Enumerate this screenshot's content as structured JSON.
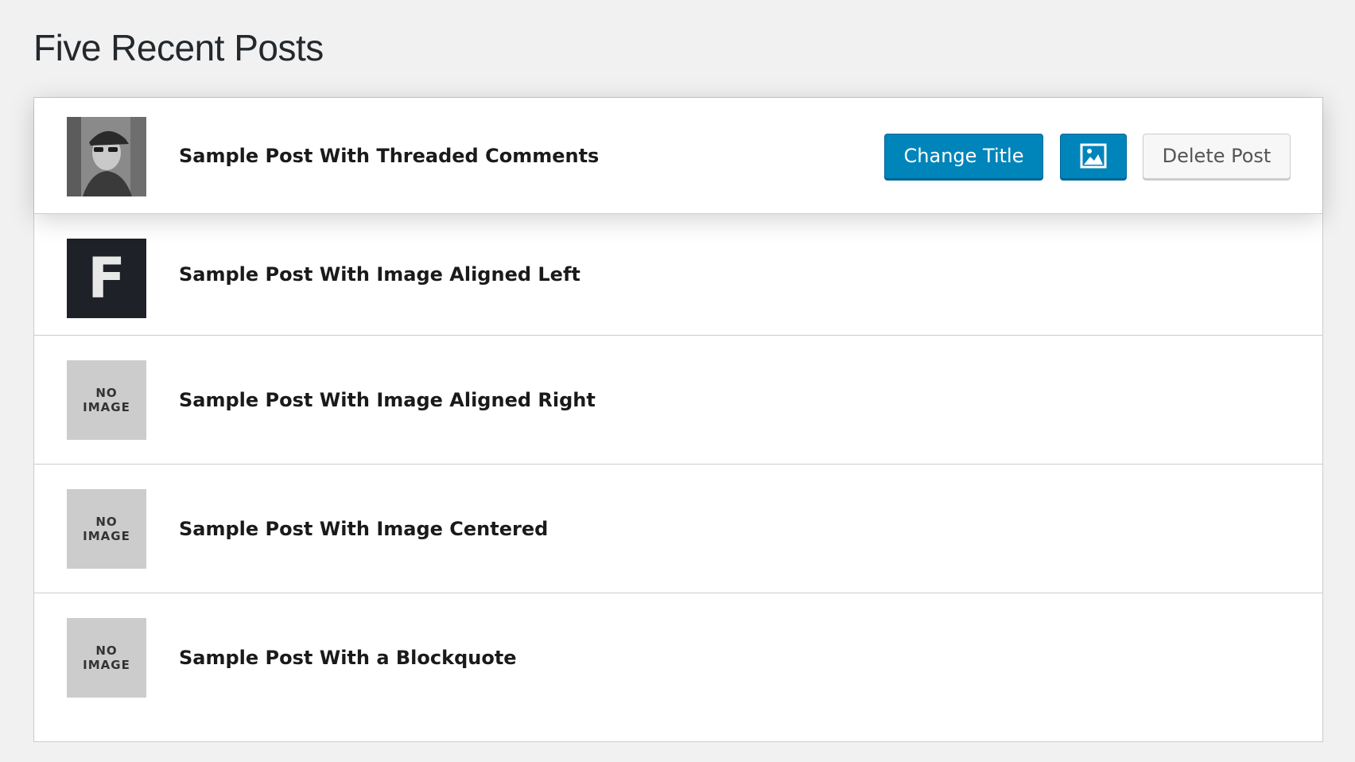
{
  "page": {
    "title": "Five Recent Posts"
  },
  "posts": [
    {
      "title": "Sample Post With Threaded Comments",
      "thumbnail": "photo",
      "active": true
    },
    {
      "title": "Sample Post With Image Aligned Left",
      "thumbnail": "letter",
      "thumbnail_letter": "F"
    },
    {
      "title": "Sample Post With Image Aligned Right",
      "thumbnail": "none",
      "no_image_line1": "NO",
      "no_image_line2": "IMAGE"
    },
    {
      "title": "Sample Post With Image Centered",
      "thumbnail": "none",
      "no_image_line1": "NO",
      "no_image_line2": "IMAGE"
    },
    {
      "title": "Sample Post With a Blockquote",
      "thumbnail": "none",
      "no_image_line1": "NO",
      "no_image_line2": "IMAGE"
    }
  ],
  "actions": {
    "change_title_label": "Change Title",
    "image_button_icon": "image-icon",
    "delete_label": "Delete Post"
  },
  "colors": {
    "primary": "#0085ba",
    "primary_border": "#006799",
    "background": "#f1f1f1",
    "no_image_bg": "#cccccc",
    "letter_thumb_bg": "#1e2127"
  }
}
